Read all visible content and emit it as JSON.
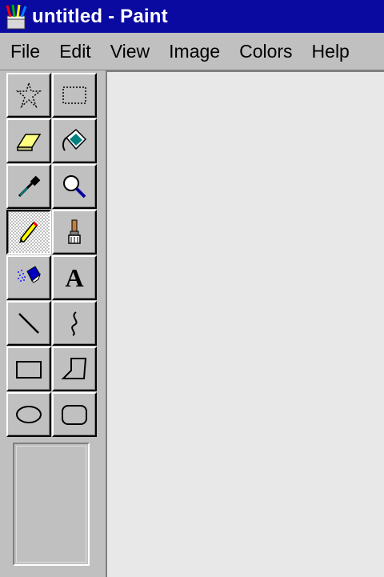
{
  "window": {
    "title": "untitled - Paint",
    "app_icon": "paint-brushes-icon",
    "titlebar_color": "#0a0aa0"
  },
  "menu": {
    "items": [
      {
        "label": "File"
      },
      {
        "label": "Edit"
      },
      {
        "label": "View"
      },
      {
        "label": "Image"
      },
      {
        "label": "Colors"
      },
      {
        "label": "Help"
      }
    ]
  },
  "toolbox": {
    "selected_tool": "pencil",
    "tools": [
      {
        "name": "free-form-select",
        "icon": "star-select-icon"
      },
      {
        "name": "select",
        "icon": "rect-select-icon"
      },
      {
        "name": "eraser",
        "icon": "eraser-icon"
      },
      {
        "name": "fill-with-color",
        "icon": "paint-bucket-icon"
      },
      {
        "name": "pick-color",
        "icon": "eyedropper-icon"
      },
      {
        "name": "magnifier",
        "icon": "magnifier-icon"
      },
      {
        "name": "pencil",
        "icon": "pencil-icon"
      },
      {
        "name": "brush",
        "icon": "brush-icon"
      },
      {
        "name": "airbrush",
        "icon": "airbrush-icon"
      },
      {
        "name": "text",
        "icon": "text-icon",
        "glyph": "A"
      },
      {
        "name": "line",
        "icon": "line-icon"
      },
      {
        "name": "curve",
        "icon": "curve-icon"
      },
      {
        "name": "rectangle",
        "icon": "rectangle-icon"
      },
      {
        "name": "polygon",
        "icon": "polygon-icon"
      },
      {
        "name": "ellipse",
        "icon": "ellipse-icon"
      },
      {
        "name": "rounded-rectangle",
        "icon": "rounded-rect-icon"
      }
    ]
  },
  "canvas": {
    "background": "#e8e8e8"
  }
}
